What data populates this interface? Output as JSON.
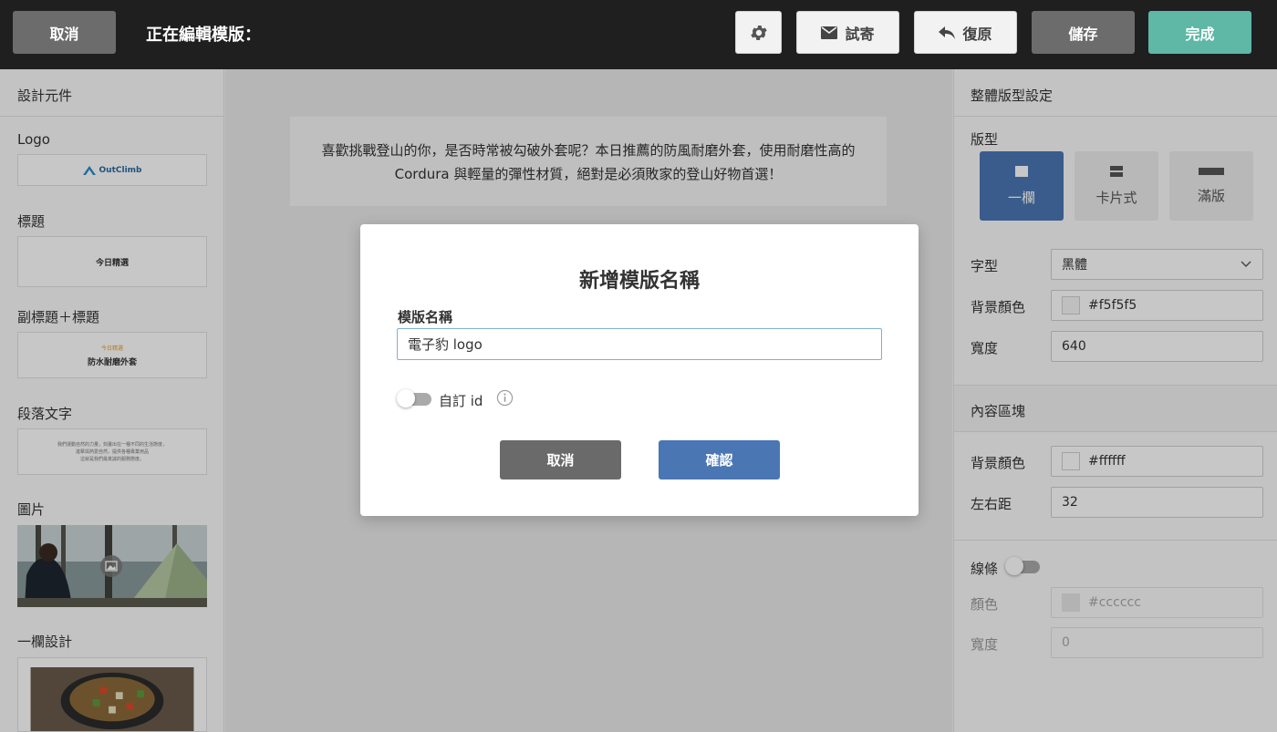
{
  "topbar": {
    "cancel_label": "取消",
    "editing_label": "正在編輯模版：",
    "test_send_label": "試寄",
    "revert_label": "復原",
    "save_label": "儲存",
    "done_label": "完成"
  },
  "left_panel": {
    "title": "設計元件",
    "components": [
      {
        "label": "Logo",
        "preview_text": "OutClimb"
      },
      {
        "label": "標題",
        "preview_text": "今日精選"
      },
      {
        "label": "副標題＋標題",
        "preview_sub": "今日精選",
        "preview_text": "防水耐磨外套"
      },
      {
        "label": "段落文字",
        "preview_lines": [
          "我們運動自然的力量，刻畫出在一種不同的生活態度，",
          "進擊與熱愛自然，提供各種專業用品",
          "這就是我們最真誠的服務態度。"
        ]
      },
      {
        "label": "圖片"
      },
      {
        "label": "一欄設計"
      }
    ]
  },
  "canvas": {
    "paragraph": "喜歡挑戰登山的你，是否時常被勾破外套呢？本日推薦的防風耐磨外套，使用耐磨性高的 Cordura 與輕量的彈性材質，絕對是必須敗家的登山好物首選！"
  },
  "right_panel": {
    "title": "整體版型設定",
    "layout_label": "版型",
    "layouts": [
      {
        "label": "一欄",
        "active": true
      },
      {
        "label": "卡片式",
        "active": false
      },
      {
        "label": "滿版",
        "active": false
      }
    ],
    "font_label": "字型",
    "font_value": "黑體",
    "bg_color_label": "背景顏色",
    "bg_color_value": "#f5f5f5",
    "width_label": "寬度",
    "width_value": "640",
    "content_section_title": "內容區塊",
    "content_bg_label": "背景顏色",
    "content_bg_value": "#ffffff",
    "padding_label": "左右距",
    "padding_value": "32",
    "line_label": "線條",
    "line_enabled": false,
    "line_color_label": "顏色",
    "line_color_value": "#cccccc",
    "line_width_label": "寬度",
    "line_width_value": "0"
  },
  "modal": {
    "title": "新增模版名稱",
    "name_label": "模版名稱",
    "name_value": "電子豹 logo",
    "custom_id_label": "自訂 id",
    "custom_id_enabled": false,
    "cancel_label": "取消",
    "confirm_label": "確認"
  },
  "colors": {
    "topbar_bg": "#1f1f1f",
    "done_button": "#5fb8a6",
    "primary_blue": "#4a76b4",
    "dark_button": "#6c6c6c"
  }
}
